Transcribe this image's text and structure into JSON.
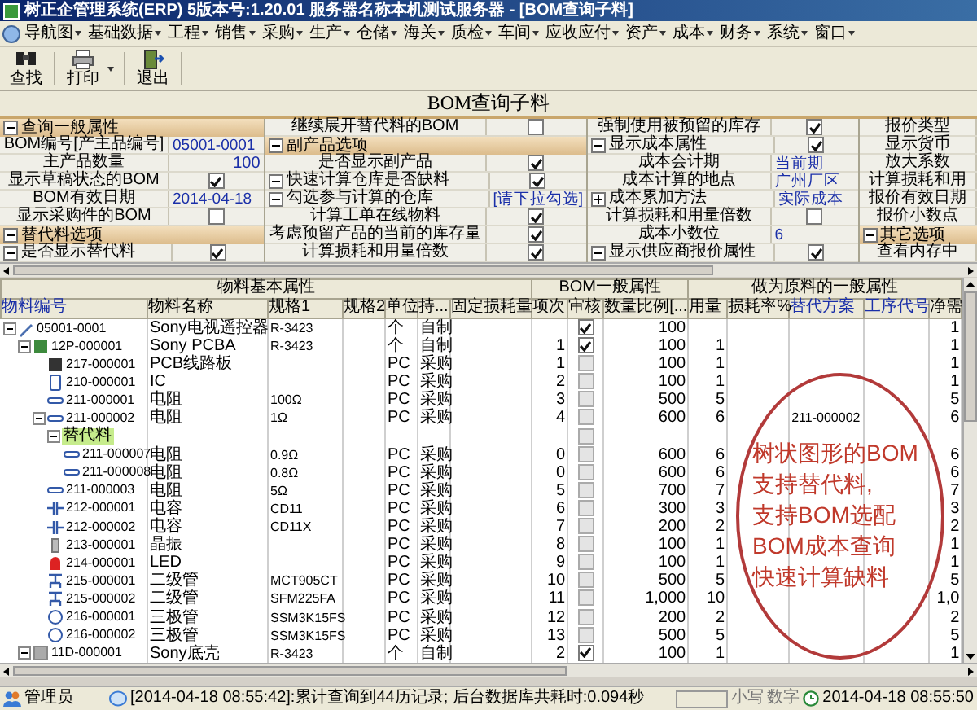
{
  "window": {
    "title": "树正企管理系统(ERP) 5版本号:1.20.01 服务器名称本机测试服务器 - [BOM查询子料]"
  },
  "menu": [
    {
      "label": "导航图"
    },
    {
      "label": "基础数据"
    },
    {
      "label": "工程"
    },
    {
      "label": "销售"
    },
    {
      "label": "采购"
    },
    {
      "label": "生产"
    },
    {
      "label": "仓储"
    },
    {
      "label": "海关"
    },
    {
      "label": "质检"
    },
    {
      "label": "车间"
    },
    {
      "label": "应收应付"
    },
    {
      "label": "资产"
    },
    {
      "label": "成本"
    },
    {
      "label": "财务"
    },
    {
      "label": "系统"
    },
    {
      "label": "窗口"
    }
  ],
  "toolbar": [
    {
      "kind": "find",
      "label": "查找",
      "dropdown": false
    },
    {
      "kind": "print",
      "label": "打印",
      "dropdown": true
    },
    {
      "kind": "exit",
      "label": "退出",
      "dropdown": false
    }
  ],
  "form_title": "BOM查询子料",
  "options": {
    "columns": [
      [
        {
          "kind": "section",
          "label": "查询一般属性",
          "expanded": true
        },
        {
          "kind": "field",
          "label": "BOM编号[产主品编号]",
          "value": "05001-0001"
        },
        {
          "kind": "number",
          "label": "主产品数量",
          "value": "100"
        },
        {
          "kind": "check",
          "label": "显示草稿状态的BOM",
          "checked": true
        },
        {
          "kind": "field",
          "label": "BOM有效日期",
          "value": "2014-04-18"
        },
        {
          "kind": "check",
          "label": "显示采购件的BOM",
          "checked": false
        },
        {
          "kind": "section",
          "label": "替代料选项",
          "expanded": true
        },
        {
          "kind": "check",
          "label": "是否显示替代料",
          "checked": true,
          "expanded": true
        }
      ],
      [
        {
          "kind": "check",
          "label": "继续展开替代料的BOM",
          "checked": false
        },
        {
          "kind": "section",
          "label": "副产品选项",
          "expanded": true
        },
        {
          "kind": "check",
          "label": "是否显示副产品",
          "checked": true
        },
        {
          "kind": "check",
          "label": "快速计算仓库是否缺料",
          "checked": true,
          "expanded": true
        },
        {
          "kind": "field",
          "label": "勾选参与计算的仓库",
          "value": "[请下拉勾选]",
          "expanded": true
        },
        {
          "kind": "check",
          "label": "计算工单在线物料",
          "checked": true
        },
        {
          "kind": "check",
          "label": "考虑预留产品的当前的库存量",
          "checked": true
        },
        {
          "kind": "check",
          "label": "计算损耗和用量倍数",
          "checked": true
        }
      ],
      [
        {
          "kind": "check",
          "label": "强制使用被预留的库存",
          "checked": true
        },
        {
          "kind": "check",
          "label": "显示成本属性",
          "checked": true,
          "expanded": true
        },
        {
          "kind": "field",
          "label": "成本会计期",
          "value": "当前期"
        },
        {
          "kind": "field",
          "label": "成本计算的地点",
          "value": "广州厂区"
        },
        {
          "kind": "field",
          "label": "成本累加方法",
          "value": "实际成本",
          "expanded": false
        },
        {
          "kind": "check",
          "label": "计算损耗和用量倍数",
          "checked": false
        },
        {
          "kind": "field",
          "label": "成本小数位",
          "value": "6"
        },
        {
          "kind": "check",
          "label": "显示供应商报价属性",
          "checked": true,
          "expanded": true
        }
      ],
      [
        {
          "kind": "label",
          "label": "报价类型"
        },
        {
          "kind": "label",
          "label": "显示货币"
        },
        {
          "kind": "label",
          "label": "放大系数"
        },
        {
          "kind": "label",
          "label": "计算损耗和用"
        },
        {
          "kind": "label",
          "label": "报价有效日期"
        },
        {
          "kind": "label",
          "label": "报价小数点"
        },
        {
          "kind": "section",
          "label": "其它选项",
          "expanded": true
        },
        {
          "kind": "label",
          "label": "查看内存中"
        }
      ]
    ]
  },
  "table": {
    "groups": [
      {
        "label": "物料基本属性",
        "columns": [
          {
            "label": "物料编号",
            "emphasis": true
          },
          {
            "label": "物料名称",
            "emphasis": false
          },
          {
            "label": "规格1",
            "emphasis": false
          },
          {
            "label": "规格2",
            "emphasis": false
          },
          {
            "label": "单位",
            "emphasis": false
          },
          {
            "label": "持...",
            "emphasis": false
          },
          {
            "label": "固定损耗量",
            "emphasis": false
          }
        ]
      },
      {
        "label": "BOM一般属性",
        "columns": [
          {
            "label": "项次",
            "emphasis": false
          },
          {
            "label": "审核",
            "emphasis": false
          },
          {
            "label": "数量比例[...",
            "emphasis": false
          }
        ]
      },
      {
        "label": "做为原料的一般属性",
        "columns": [
          {
            "label": "用量",
            "emphasis": false
          },
          {
            "label": "损耗率%",
            "emphasis": false
          },
          {
            "label": "替代方案",
            "emphasis": true
          },
          {
            "label": "工序代号",
            "emphasis": true
          },
          {
            "label": "净需",
            "emphasis": false
          }
        ]
      }
    ],
    "rows": [
      {
        "code": "05001-0001",
        "kind": "product",
        "selected": false,
        "expanded": true,
        "name": "Sony电视遥控器",
        "spec1": "R-3423",
        "unit": "个",
        "source": "自制",
        "approved": true,
        "ratio": "100",
        "net": "1",
        "children": [
          {
            "code": "12P-000001",
            "kind": "pcba",
            "selected": false,
            "expanded": true,
            "name": "Sony PCBA",
            "spec1": "R-3423",
            "unit": "个",
            "source": "自制",
            "seq": "1",
            "approved": true,
            "ratio": "100",
            "usage": "1",
            "net": "1",
            "children": [
              {
                "code": "217-000001",
                "kind": "board",
                "selected": false,
                "name": "PCB线路板",
                "unit": "PC",
                "source": "采购",
                "seq": "1",
                "approved": false,
                "ratio": "100",
                "usage": "1",
                "net": "1"
              },
              {
                "code": "210-000001",
                "kind": "ic",
                "selected": false,
                "name": "IC",
                "unit": "PC",
                "source": "采购",
                "seq": "2",
                "approved": false,
                "ratio": "100",
                "usage": "1",
                "net": "1"
              },
              {
                "code": "211-000001",
                "kind": "resistor",
                "selected": false,
                "name": "电阻",
                "spec1": "100Ω",
                "unit": "PC",
                "source": "采购",
                "seq": "3",
                "approved": false,
                "ratio": "500",
                "usage": "5",
                "net": "5"
              },
              {
                "code": "211-000002",
                "kind": "resistor",
                "selected": false,
                "expanded": true,
                "name": "电阻",
                "spec1": "1Ω",
                "unit": "PC",
                "source": "采购",
                "seq": "4",
                "approved": false,
                "ratio": "600",
                "usage": "6",
                "substitute": "211-000002",
                "net": "6",
                "children": [
                  {
                    "code": "替代料",
                    "kind": "substitute-group",
                    "selected": true,
                    "expanded": true,
                    "approved": false,
                    "children": [
                      {
                        "code": "211-000007",
                        "kind": "resistor",
                        "selected": false,
                        "name": "电阻",
                        "spec1": "0.9Ω",
                        "unit": "PC",
                        "source": "采购",
                        "seq": "0",
                        "approved": false,
                        "ratio": "600",
                        "usage": "6",
                        "net": "6"
                      },
                      {
                        "code": "211-000008",
                        "kind": "resistor",
                        "selected": false,
                        "name": "电阻",
                        "spec1": "0.8Ω",
                        "unit": "PC",
                        "source": "采购",
                        "seq": "0",
                        "approved": false,
                        "ratio": "600",
                        "usage": "6",
                        "net": "6"
                      }
                    ]
                  }
                ]
              },
              {
                "code": "211-000003",
                "kind": "resistor",
                "selected": false,
                "name": "电阻",
                "spec1": "5Ω",
                "unit": "PC",
                "source": "采购",
                "seq": "5",
                "approved": false,
                "ratio": "700",
                "usage": "7",
                "net": "7"
              },
              {
                "code": "212-000001",
                "kind": "capacitor",
                "selected": false,
                "name": "电容",
                "spec1": "CD11",
                "unit": "PC",
                "source": "采购",
                "seq": "6",
                "approved": false,
                "ratio": "300",
                "usage": "3",
                "net": "3"
              },
              {
                "code": "212-000002",
                "kind": "capacitor",
                "selected": false,
                "name": "电容",
                "spec1": "CD11X",
                "unit": "PC",
                "source": "采购",
                "seq": "7",
                "approved": false,
                "ratio": "200",
                "usage": "2",
                "net": "2"
              },
              {
                "code": "213-000001",
                "kind": "crystal",
                "selected": false,
                "name": "晶振",
                "unit": "PC",
                "source": "采购",
                "seq": "8",
                "approved": false,
                "ratio": "100",
                "usage": "1",
                "net": "1"
              },
              {
                "code": "214-000001",
                "kind": "led",
                "selected": false,
                "name": "LED",
                "unit": "PC",
                "source": "采购",
                "seq": "9",
                "approved": false,
                "ratio": "100",
                "usage": "1",
                "net": "1"
              },
              {
                "code": "215-000001",
                "kind": "diode",
                "selected": false,
                "name": "二级管",
                "spec1": "MCT905CT",
                "unit": "PC",
                "source": "采购",
                "seq": "10",
                "approved": false,
                "ratio": "500",
                "usage": "5",
                "net": "5"
              },
              {
                "code": "215-000002",
                "kind": "diode",
                "selected": false,
                "name": "二级管",
                "spec1": "SFM225FA",
                "unit": "PC",
                "source": "采购",
                "seq": "11",
                "approved": false,
                "ratio": "1,000",
                "usage": "10",
                "net": "1,0"
              },
              {
                "code": "216-000001",
                "kind": "transistor",
                "selected": false,
                "name": "三极管",
                "spec1": "SSM3K15FS",
                "unit": "PC",
                "source": "采购",
                "seq": "12",
                "approved": false,
                "ratio": "200",
                "usage": "2",
                "net": "2"
              },
              {
                "code": "216-000002",
                "kind": "transistor",
                "selected": false,
                "name": "三极管",
                "spec1": "SSM3K15FS",
                "unit": "PC",
                "source": "采购",
                "seq": "13",
                "approved": false,
                "ratio": "500",
                "usage": "5",
                "net": "5"
              }
            ]
          },
          {
            "code": "11D-000001",
            "kind": "housing",
            "selected": false,
            "expanded": true,
            "name": "Sony底壳",
            "spec1": "R-3423",
            "unit": "个",
            "source": "自制",
            "seq": "2",
            "approved": true,
            "ratio": "100",
            "usage": "1",
            "net": "1"
          }
        ]
      }
    ]
  },
  "callout": {
    "lines": [
      "树状图形的BOM",
      "支持替代料,",
      "支持BOM选配",
      "BOM成本查询",
      "快速计算缺料"
    ]
  },
  "status_bar": {
    "user": "管理员",
    "message": "[2014-04-18 08:55:42]:累计查询到44历记录; 后台数据库共耗时:0.094秒",
    "indicators": [
      "小写",
      "数字"
    ],
    "time": "2014-04-18 08:55:50"
  }
}
